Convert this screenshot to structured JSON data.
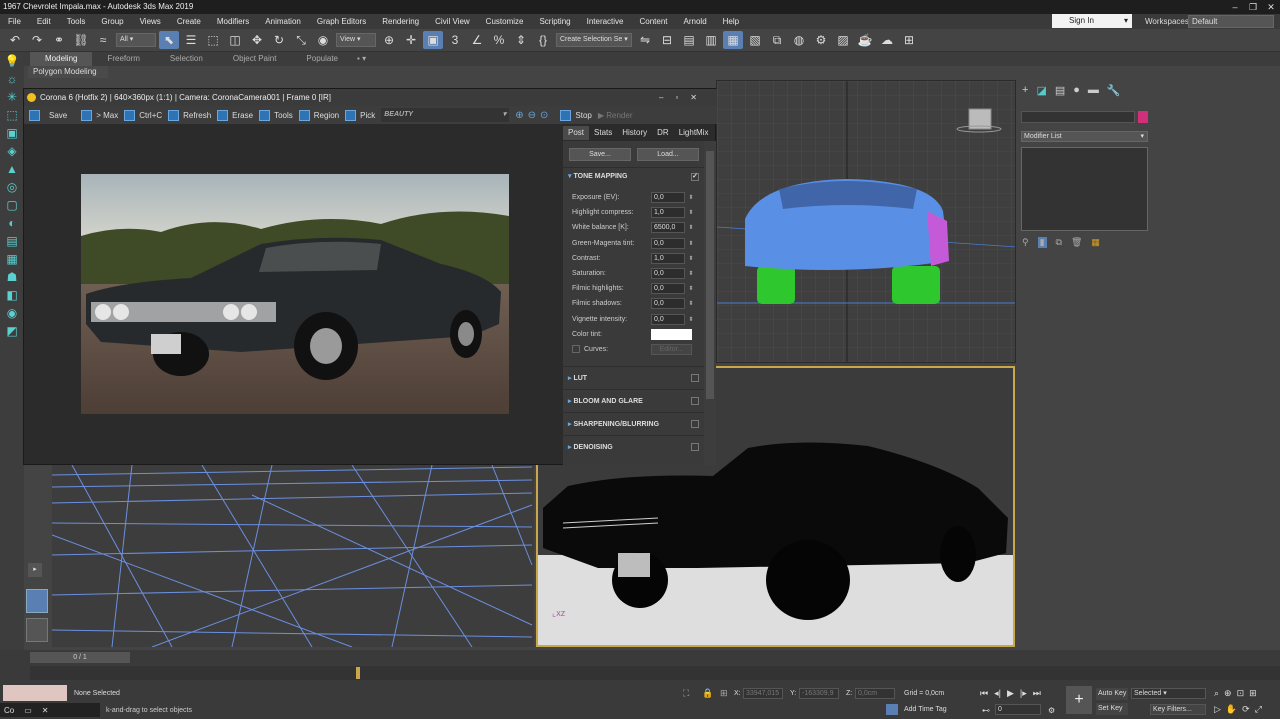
{
  "window": {
    "title": "1967 Chevrolet Impala.max - Autodesk 3ds Max 2019"
  },
  "menu": [
    "File",
    "Edit",
    "Tools",
    "Group",
    "Views",
    "Create",
    "Modifiers",
    "Animation",
    "Graph Editors",
    "Rendering",
    "Civil View",
    "Customize",
    "Scripting",
    "Interactive",
    "Content",
    "Arnold",
    "Help"
  ],
  "account": {
    "signin": "Sign In",
    "workspaces_label": "Workspaces:",
    "workspace": "Default"
  },
  "toolbar": {
    "filter": "All",
    "ref_coord": "View",
    "selection_set": "Create Selection Se"
  },
  "ribbon": {
    "tabs": [
      "Modeling",
      "Freeform",
      "Selection",
      "Object Paint",
      "Populate"
    ],
    "sub": "Polygon Modeling"
  },
  "corona": {
    "title": "Corona 6 (Hotfix 2) | 640×360px (1:1) | Camera: CoronaCamera001 | Frame 0 [IR]",
    "buttons": [
      "Save",
      "> Max",
      "Ctrl+C",
      "Refresh",
      "Erase",
      "Tools",
      "Region",
      "Pick"
    ],
    "pass": "BEAUTY",
    "stop": "Stop",
    "render": "Render",
    "tabs": [
      "Post",
      "Stats",
      "History",
      "DR",
      "LightMix"
    ],
    "save_btn": "Save...",
    "load_btn": "Load...",
    "tone_mapping": "TONE MAPPING",
    "params": [
      {
        "label": "Exposure (EV):",
        "value": "0,0"
      },
      {
        "label": "Highlight compress:",
        "value": "1,0"
      },
      {
        "label": "White balance [K]:",
        "value": "6500,0"
      },
      {
        "label": "Green-Magenta tint:",
        "value": "0,0"
      },
      {
        "label": "Contrast:",
        "value": "1,0"
      },
      {
        "label": "Saturation:",
        "value": "0,0"
      },
      {
        "label": "Filmic highlights:",
        "value": "0,0"
      },
      {
        "label": "Filmic shadows:",
        "value": "0,0"
      },
      {
        "label": "Vignette intensity:",
        "value": "0,0"
      }
    ],
    "color_tint": "Color tint:",
    "curves": "Curves:",
    "editor": "Editor...",
    "sections": [
      "LUT",
      "BLOOM AND GLARE",
      "SHARPENING/BLURRING",
      "DENOISING"
    ]
  },
  "cmdpanel": {
    "modifier_list": "Modifier List"
  },
  "timeline": {
    "frame": "0 / 1"
  },
  "status": {
    "selected": "None Selected",
    "hint": "k-and-drag to select objects",
    "x_label": "X:",
    "x_val": "33947,015",
    "y_label": "Y:",
    "y_val": "-163309,9",
    "z_label": "Z:",
    "z_val": "0,0cm",
    "grid": "Grid = 0,0cm",
    "add_time_tag": "Add Time Tag",
    "auto_key": "Auto Key",
    "set_key": "Set Key",
    "selected_mode": "Selected",
    "key_filters": "Key Filters...",
    "frame_field": "0",
    "script_label": "Co"
  },
  "colors": {
    "accent": "#5a7fb3",
    "viewport_active": "#c8a84a",
    "wire_blue": "#6b8fe0"
  }
}
